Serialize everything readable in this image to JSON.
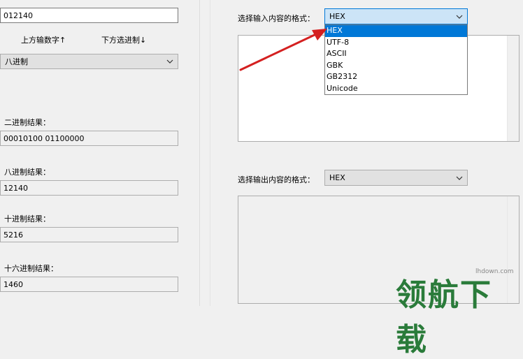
{
  "left": {
    "top_input_value": "012140",
    "swap_up_label": "上方输数字↑",
    "swap_down_label": "下方选进制↓",
    "base_select_value": "八进制",
    "binary_label": "二进制结果：",
    "binary_value": "00010100 01100000",
    "octal_label": "八进制结果：",
    "octal_value": "12140",
    "decimal_label": "十进制结果：",
    "decimal_value": "5216",
    "hex_label": "十六进制结果：",
    "hex_value": "1460"
  },
  "right": {
    "input_format_label": "选择输入内容的格式：",
    "input_format_value": "HEX",
    "input_format_options": [
      "HEX",
      "UTF-8",
      "ASCII",
      "GBK",
      "GB2312",
      "Unicode"
    ],
    "selected_option_index": 0,
    "output_format_label": "选择输出内容的格式：",
    "output_format_value": "HEX"
  },
  "watermark": {
    "text": "领航下载",
    "url": "lhdown.com"
  },
  "colors": {
    "arrow": "#d42020",
    "selection": "#0078d7",
    "watermark": "#2a7b3a"
  }
}
